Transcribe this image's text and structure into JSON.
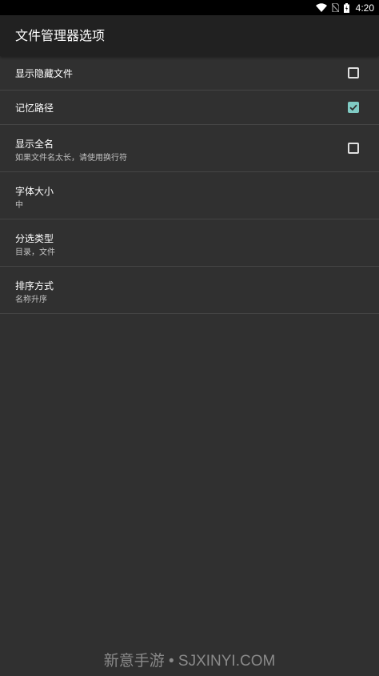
{
  "status_bar": {
    "time": "4:20",
    "icons": [
      "wifi-icon",
      "no-sim-icon",
      "battery-charging-icon"
    ]
  },
  "app_bar": {
    "title": "文件管理器选项"
  },
  "settings": {
    "items": [
      {
        "title": "显示隐藏文件",
        "subtitle": "",
        "control": "checkbox",
        "checked": false
      },
      {
        "title": "记忆路径",
        "subtitle": "",
        "control": "checkbox",
        "checked": true
      },
      {
        "title": "显示全名",
        "subtitle": "如果文件名太长，请使用换行符",
        "control": "checkbox",
        "checked": false
      },
      {
        "title": "字体大小",
        "subtitle": "中",
        "control": "none"
      },
      {
        "title": "分选类型",
        "subtitle": "目录，文件",
        "control": "none"
      },
      {
        "title": "排序方式",
        "subtitle": "名称升序",
        "control": "none"
      }
    ]
  },
  "watermark": {
    "text": "新意手游 • SJXINYI.COM"
  },
  "colors": {
    "background": "#303030",
    "app_bar": "#212121",
    "status_bar": "#000000",
    "divider": "#454545",
    "accent": "#80cbc4",
    "primary_text": "#ffffff",
    "secondary_text": "#c2c2c2"
  }
}
